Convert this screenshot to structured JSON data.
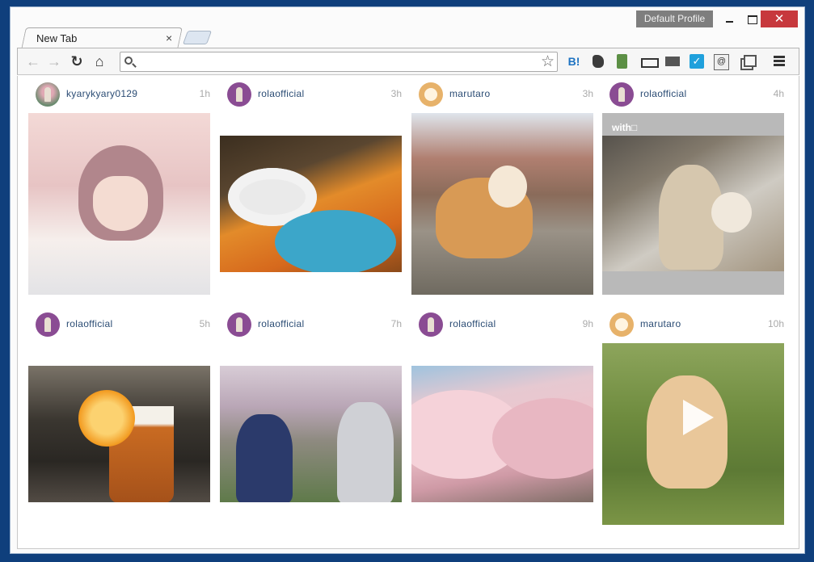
{
  "window": {
    "profile_label": "Default Profile",
    "close_glyph": "✕"
  },
  "tab": {
    "title": "New Tab",
    "close_glyph": "×"
  },
  "toolbar": {
    "back_glyph": "←",
    "forward_glyph": "→",
    "reload_glyph": "↻",
    "home_glyph": "⌂",
    "omnibox_value": "",
    "star_glyph": "☆",
    "extensions": [
      "hatena-bookmark-icon",
      "evernote-icon",
      "pin-icon",
      "ruler-icon",
      "mail-icon",
      "checkmark-icon",
      "note-icon",
      "window-icon"
    ],
    "hatena_label": "B!"
  },
  "feed": {
    "posts": [
      {
        "username": "kyarykyary0129",
        "time": "1h"
      },
      {
        "username": "rolaofficial",
        "time": "3h"
      },
      {
        "username": "marutaro",
        "time": "3h"
      },
      {
        "username": "rolaofficial",
        "time": "4h",
        "caption": "with□"
      },
      {
        "username": "rolaofficial",
        "time": "5h"
      },
      {
        "username": "rolaofficial",
        "time": "7h"
      },
      {
        "username": "rolaofficial",
        "time": "9h"
      },
      {
        "username": "marutaro",
        "time": "10h"
      }
    ]
  },
  "colors": {
    "background": "#0f3f7c",
    "username": "#2b4c74",
    "close_button": "#c7383d",
    "timestamp": "#aaaaaa"
  }
}
